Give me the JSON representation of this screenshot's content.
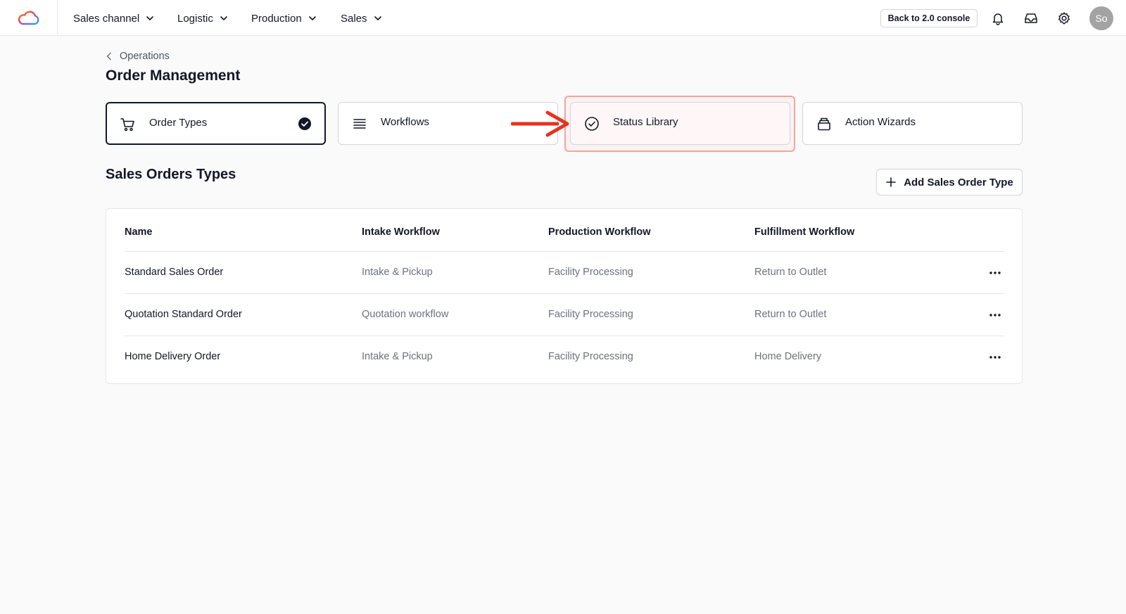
{
  "nav": {
    "items": [
      {
        "label": "Sales channel"
      },
      {
        "label": "Logistic"
      },
      {
        "label": "Production"
      },
      {
        "label": "Sales"
      }
    ],
    "back_label": "Back to 2.0 console",
    "avatar_initials": "So"
  },
  "breadcrumb": {
    "label": "Operations"
  },
  "page": {
    "title": "Order Management"
  },
  "tabs": [
    {
      "label": "Order Types",
      "icon": "cart-icon",
      "selected": true
    },
    {
      "label": "Workflows",
      "icon": "list-icon",
      "selected": false
    },
    {
      "label": "Status Library",
      "icon": "check-circle-icon",
      "selected": false
    },
    {
      "label": "Action Wizards",
      "icon": "stack-icon",
      "selected": false
    }
  ],
  "section": {
    "title": "Sales Orders Types",
    "add_label": "Add Sales Order Type"
  },
  "table": {
    "headers": [
      "Name",
      "Intake Workflow",
      "Production Workflow",
      "Fulfillment Workflow"
    ],
    "rows": [
      {
        "name": "Standard Sales Order",
        "intake": "Intake & Pickup",
        "production": "Facility Processing",
        "fulfillment": "Return to Outlet"
      },
      {
        "name": "Quotation Standard Order",
        "intake": "Quotation workflow",
        "production": "Facility Processing",
        "fulfillment": "Return to Outlet"
      },
      {
        "name": "Home Delivery Order",
        "intake": "Intake & Pickup",
        "production": "Facility Processing",
        "fulfillment": "Home Delivery"
      }
    ]
  },
  "colors": {
    "annotation_arrow": "#e8321e",
    "highlight_border": "#f5a3a3"
  }
}
